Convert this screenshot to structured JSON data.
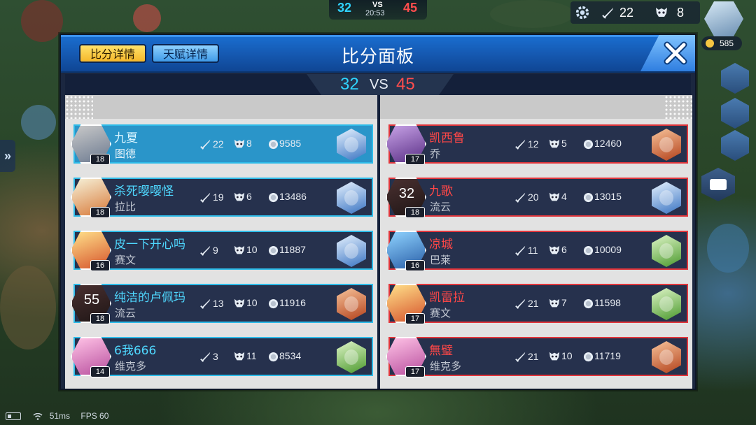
{
  "hud": {
    "score_blue": "32",
    "score_red": "45",
    "vs": "VS",
    "time": "20:53",
    "kills": "22",
    "deaths": "8",
    "gold": "585",
    "status": {
      "ping": "51ms",
      "fps": "FPS 60"
    }
  },
  "dialog": {
    "tabs": [
      {
        "label": "比分详情",
        "active": true
      },
      {
        "label": "天赋详情",
        "active": false
      }
    ],
    "title": "比分面板",
    "score_blue": "32",
    "vs": "VS",
    "score_red": "45"
  },
  "colors": {
    "blue_team": "#2ebbe8",
    "red_team": "#e0363c",
    "header": "#1a6fd1",
    "tab_active": "#f5b72a"
  },
  "blue_team": [
    {
      "name": "九夏",
      "hero": "图德",
      "level": "18",
      "kills": "22",
      "deaths": "8",
      "gold": "9585",
      "self": true,
      "respawn": "",
      "avatar": [
        "#c9c9c9",
        "#6c7a90"
      ],
      "item": [
        "#e6f2ff",
        "#3a74c2"
      ]
    },
    {
      "name": "杀死嘤嘤怪",
      "hero": "拉比",
      "level": "18",
      "kills": "19",
      "deaths": "6",
      "gold": "13486",
      "self": false,
      "respawn": "",
      "avatar": [
        "#f6f1d8",
        "#d87a3a"
      ],
      "item": [
        "#e6f2ff",
        "#3a74c2"
      ]
    },
    {
      "name": "皮一下开心吗",
      "hero": "赛文",
      "level": "16",
      "kills": "9",
      "deaths": "10",
      "gold": "11887",
      "self": false,
      "respawn": "",
      "avatar": [
        "#ffe08a",
        "#d6542c"
      ],
      "item": [
        "#e6f2ff",
        "#3a74c2"
      ]
    },
    {
      "name": "纯洁的卢佩玛",
      "hero": "流云",
      "level": "18",
      "kills": "13",
      "deaths": "10",
      "gold": "11916",
      "self": false,
      "respawn": "55",
      "avatar": [
        "#4a3030",
        "#1f1616"
      ],
      "item": [
        "#f6c39a",
        "#b4421c"
      ]
    },
    {
      "name": "6我666",
      "hero": "维克多",
      "level": "14",
      "kills": "3",
      "deaths": "11",
      "gold": "8534",
      "self": false,
      "respawn": "",
      "avatar": [
        "#ffc3e6",
        "#b84f9e"
      ],
      "item": [
        "#dff5c8",
        "#4c9a2e"
      ]
    }
  ],
  "red_team": [
    {
      "name": "凯西鲁",
      "hero": "乔",
      "level": "17",
      "kills": "12",
      "deaths": "5",
      "gold": "12460",
      "self": false,
      "respawn": "",
      "avatar": [
        "#c7a2e6",
        "#5a2f86"
      ],
      "item": [
        "#f6c39a",
        "#b4421c"
      ]
    },
    {
      "name": "九歌",
      "hero": "流云",
      "level": "18",
      "kills": "20",
      "deaths": "4",
      "gold": "13015",
      "self": false,
      "respawn": "32",
      "avatar": [
        "#4a3030",
        "#1f1616"
      ],
      "item": [
        "#e6f2ff",
        "#3a74c2"
      ]
    },
    {
      "name": "凉城",
      "hero": "巴莱",
      "level": "16",
      "kills": "11",
      "deaths": "6",
      "gold": "10009",
      "self": false,
      "respawn": "",
      "avatar": [
        "#8fd3ff",
        "#2a5fa8"
      ],
      "item": [
        "#dff5c8",
        "#4c9a2e"
      ]
    },
    {
      "name": "凯雷拉",
      "hero": "赛文",
      "level": "17",
      "kills": "21",
      "deaths": "7",
      "gold": "11598",
      "self": false,
      "respawn": "",
      "avatar": [
        "#ffe08a",
        "#d6542c"
      ],
      "item": [
        "#dff5c8",
        "#4c9a2e"
      ]
    },
    {
      "name": "無璧",
      "hero": "维克多",
      "level": "17",
      "kills": "21",
      "deaths": "10",
      "gold": "11719",
      "self": false,
      "respawn": "",
      "avatar": [
        "#ffc3e6",
        "#b84f9e"
      ],
      "item": [
        "#f6c39a",
        "#b4421c"
      ]
    }
  ],
  "icons": [
    "gear-icon",
    "sword-icon",
    "skull-icon",
    "coin-icon",
    "close-icon",
    "chat-icon",
    "battery-icon",
    "wifi-icon"
  ]
}
